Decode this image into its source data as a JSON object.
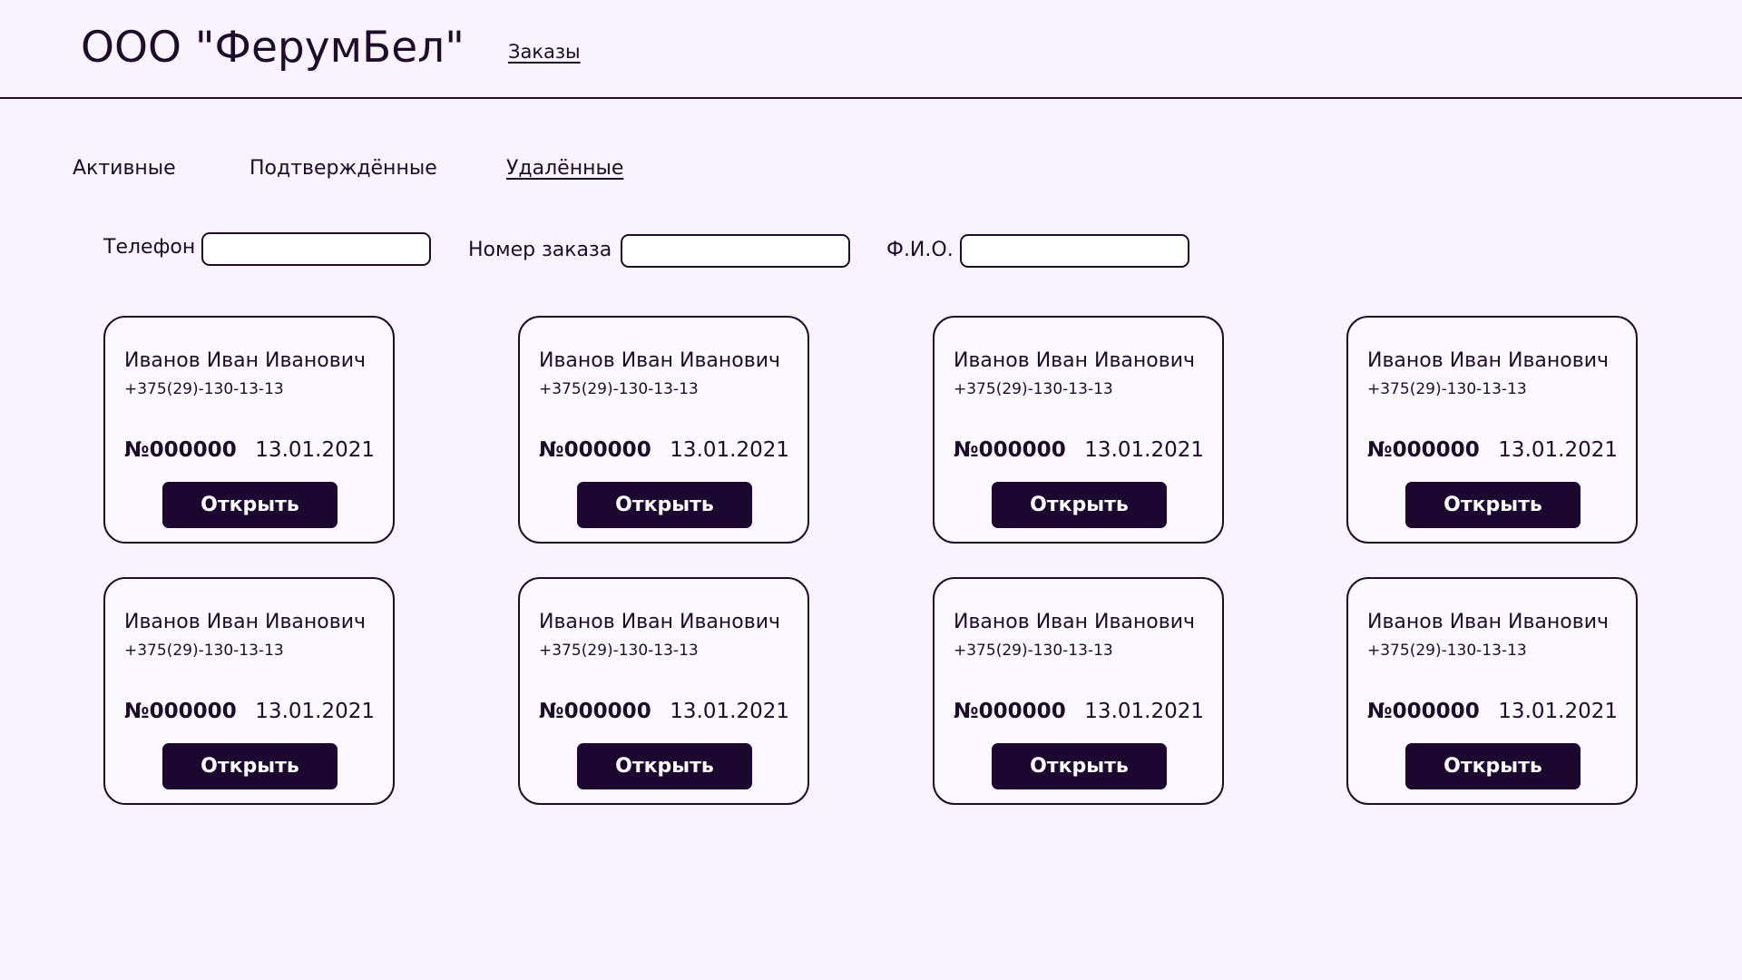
{
  "header": {
    "company_name": "ООО \"ФерумБел\"",
    "nav_orders": "Заказы"
  },
  "tabs": [
    {
      "label": "Активные",
      "active": false
    },
    {
      "label": "Подтверждённые",
      "active": false
    },
    {
      "label": "Удалённые",
      "active": true
    }
  ],
  "filters": {
    "phone_label": "Телефон",
    "phone_value": "",
    "order_number_label": "Номер заказа",
    "order_number_value": "",
    "full_name_label": "Ф.И.О.",
    "full_name_value": ""
  },
  "orders": [
    {
      "name": "Иванов Иван Иванович",
      "phone": "+375(29)-130-13-13",
      "number": "№000000",
      "date": "13.01.2021",
      "open_label": "Открыть"
    },
    {
      "name": "Иванов Иван Иванович",
      "phone": "+375(29)-130-13-13",
      "number": "№000000",
      "date": "13.01.2021",
      "open_label": "Открыть"
    },
    {
      "name": "Иванов Иван Иванович",
      "phone": "+375(29)-130-13-13",
      "number": "№000000",
      "date": "13.01.2021",
      "open_label": "Открыть"
    },
    {
      "name": "Иванов Иван Иванович",
      "phone": "+375(29)-130-13-13",
      "number": "№000000",
      "date": "13.01.2021",
      "open_label": "Открыть"
    },
    {
      "name": "Иванов Иван Иванович",
      "phone": "+375(29)-130-13-13",
      "number": "№000000",
      "date": "13.01.2021",
      "open_label": "Открыть"
    },
    {
      "name": "Иванов Иван Иванович",
      "phone": "+375(29)-130-13-13",
      "number": "№000000",
      "date": "13.01.2021",
      "open_label": "Открыть"
    },
    {
      "name": "Иванов Иван Иванович",
      "phone": "+375(29)-130-13-13",
      "number": "№000000",
      "date": "13.01.2021",
      "open_label": "Открыть"
    },
    {
      "name": "Иванов Иван Иванович",
      "phone": "+375(29)-130-13-13",
      "number": "№000000",
      "date": "13.01.2021",
      "open_label": "Открыть"
    }
  ],
  "colors": {
    "background": "#f8f3fe",
    "text": "#1c0d2b",
    "button": "#1c0730",
    "button_text": "#ffffff"
  }
}
